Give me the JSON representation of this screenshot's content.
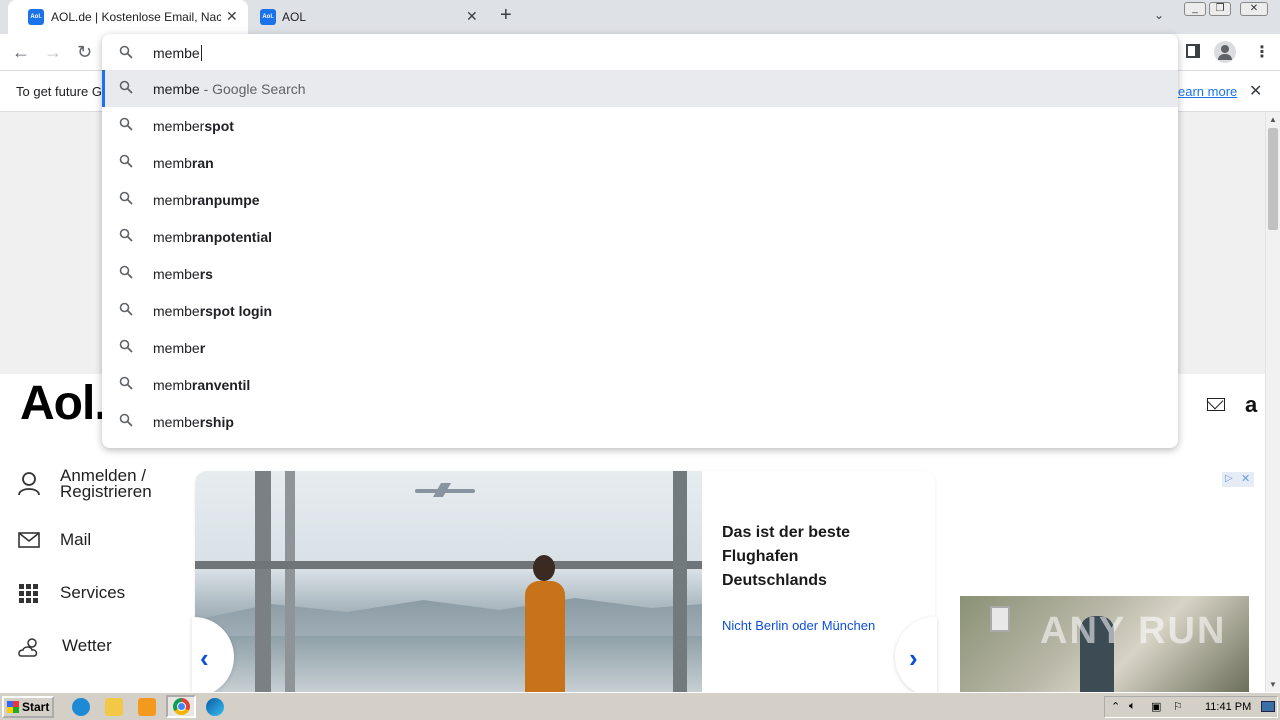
{
  "browser": {
    "tabs": [
      {
        "label": "AOL.de | Kostenlose Email, Nachrichten",
        "favicon": "Aol."
      },
      {
        "label": "AOL",
        "favicon": "Aol."
      }
    ],
    "infobar_text": "To get future G",
    "infobar_link": "earn more"
  },
  "omnibox": {
    "query": "membe",
    "suggestions": [
      {
        "typed": "membe",
        "completion": "",
        "suffix": " - Google Search"
      },
      {
        "typed": "member",
        "completion": "spot",
        "suffix": ""
      },
      {
        "typed": "memb",
        "completion": "ran",
        "suffix": ""
      },
      {
        "typed": "memb",
        "completion": "ranpumpe",
        "suffix": ""
      },
      {
        "typed": "memb",
        "completion": "ranpotential",
        "suffix": ""
      },
      {
        "typed": "membe",
        "completion": "rs",
        "suffix": ""
      },
      {
        "typed": "membe",
        "completion": "rspot login",
        "suffix": ""
      },
      {
        "typed": "membe",
        "completion": "r",
        "suffix": ""
      },
      {
        "typed": "memb",
        "completion": "ranventil",
        "suffix": ""
      },
      {
        "typed": "membe",
        "completion": "rship",
        "suffix": ""
      }
    ]
  },
  "page": {
    "logo": "Aol.",
    "sidebar": {
      "signin_line1": "Anmelden /",
      "signin_line2": "Registrieren",
      "mail": "Mail",
      "services": "Services",
      "weather": "Wetter"
    },
    "article": {
      "headline_1": "Das ist der beste",
      "headline_2": "Flughafen",
      "headline_3": "Deutschlands",
      "subtitle": "Nicht Berlin oder München"
    },
    "watermark": "ANY RUN"
  },
  "taskbar": {
    "start": "Start",
    "time": "11:41 PM"
  },
  "colors": {
    "accent": "#1a73e8",
    "aol_blue": "#0e4fd8",
    "tab_strip": "#dee1e6",
    "taskbar": "#d4d0c8"
  }
}
